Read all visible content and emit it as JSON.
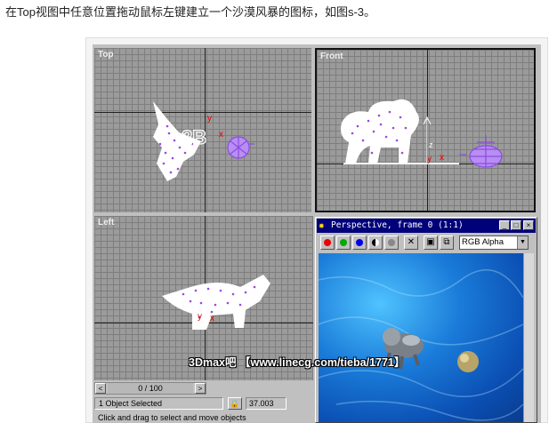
{
  "caption": "在Top视图中任意位置拖动鼠标左键建立一个沙漠风暴的图标，如图s-3。",
  "viewports": {
    "top": {
      "label": "Top"
    },
    "front": {
      "label": "Front"
    },
    "left": {
      "label": "Left"
    }
  },
  "perspective": {
    "title": "Perspective, frame 0 (1:1)",
    "channel": "RGB Alpha",
    "buttons": {
      "minimize": "_",
      "maximize": "□",
      "close": "×"
    }
  },
  "timeline": {
    "frame_text": "0 / 100",
    "prev": "<",
    "next": ">"
  },
  "status": {
    "selection": "1 Object Selected",
    "coord": "37.003",
    "prompt": "Click and drag to select and move objects"
  },
  "watermark": "3Dmax吧 【www.linecg.com/tieba/1771】",
  "axis_labels": {
    "x": "x",
    "y": "y",
    "z": "z"
  },
  "colors": {
    "accent": "#00007b",
    "particles": "#9a4ad8"
  }
}
